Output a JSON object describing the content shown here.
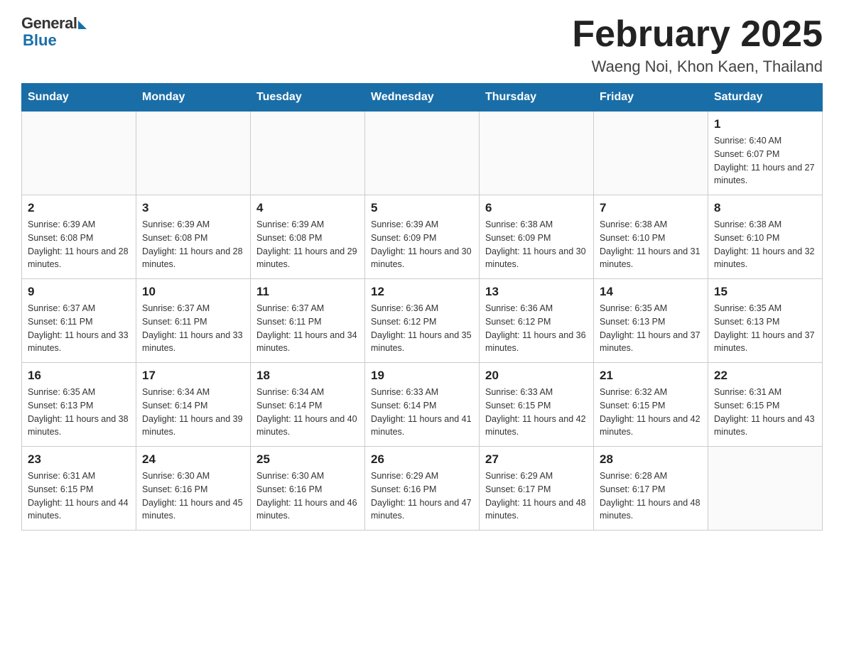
{
  "header": {
    "logo_general": "General",
    "logo_blue": "Blue",
    "month_title": "February 2025",
    "location": "Waeng Noi, Khon Kaen, Thailand"
  },
  "weekdays": [
    "Sunday",
    "Monday",
    "Tuesday",
    "Wednesday",
    "Thursday",
    "Friday",
    "Saturday"
  ],
  "weeks": [
    [
      {
        "day": "",
        "info": ""
      },
      {
        "day": "",
        "info": ""
      },
      {
        "day": "",
        "info": ""
      },
      {
        "day": "",
        "info": ""
      },
      {
        "day": "",
        "info": ""
      },
      {
        "day": "",
        "info": ""
      },
      {
        "day": "1",
        "info": "Sunrise: 6:40 AM\nSunset: 6:07 PM\nDaylight: 11 hours and 27 minutes."
      }
    ],
    [
      {
        "day": "2",
        "info": "Sunrise: 6:39 AM\nSunset: 6:08 PM\nDaylight: 11 hours and 28 minutes."
      },
      {
        "day": "3",
        "info": "Sunrise: 6:39 AM\nSunset: 6:08 PM\nDaylight: 11 hours and 28 minutes."
      },
      {
        "day": "4",
        "info": "Sunrise: 6:39 AM\nSunset: 6:08 PM\nDaylight: 11 hours and 29 minutes."
      },
      {
        "day": "5",
        "info": "Sunrise: 6:39 AM\nSunset: 6:09 PM\nDaylight: 11 hours and 30 minutes."
      },
      {
        "day": "6",
        "info": "Sunrise: 6:38 AM\nSunset: 6:09 PM\nDaylight: 11 hours and 30 minutes."
      },
      {
        "day": "7",
        "info": "Sunrise: 6:38 AM\nSunset: 6:10 PM\nDaylight: 11 hours and 31 minutes."
      },
      {
        "day": "8",
        "info": "Sunrise: 6:38 AM\nSunset: 6:10 PM\nDaylight: 11 hours and 32 minutes."
      }
    ],
    [
      {
        "day": "9",
        "info": "Sunrise: 6:37 AM\nSunset: 6:11 PM\nDaylight: 11 hours and 33 minutes."
      },
      {
        "day": "10",
        "info": "Sunrise: 6:37 AM\nSunset: 6:11 PM\nDaylight: 11 hours and 33 minutes."
      },
      {
        "day": "11",
        "info": "Sunrise: 6:37 AM\nSunset: 6:11 PM\nDaylight: 11 hours and 34 minutes."
      },
      {
        "day": "12",
        "info": "Sunrise: 6:36 AM\nSunset: 6:12 PM\nDaylight: 11 hours and 35 minutes."
      },
      {
        "day": "13",
        "info": "Sunrise: 6:36 AM\nSunset: 6:12 PM\nDaylight: 11 hours and 36 minutes."
      },
      {
        "day": "14",
        "info": "Sunrise: 6:35 AM\nSunset: 6:13 PM\nDaylight: 11 hours and 37 minutes."
      },
      {
        "day": "15",
        "info": "Sunrise: 6:35 AM\nSunset: 6:13 PM\nDaylight: 11 hours and 37 minutes."
      }
    ],
    [
      {
        "day": "16",
        "info": "Sunrise: 6:35 AM\nSunset: 6:13 PM\nDaylight: 11 hours and 38 minutes."
      },
      {
        "day": "17",
        "info": "Sunrise: 6:34 AM\nSunset: 6:14 PM\nDaylight: 11 hours and 39 minutes."
      },
      {
        "day": "18",
        "info": "Sunrise: 6:34 AM\nSunset: 6:14 PM\nDaylight: 11 hours and 40 minutes."
      },
      {
        "day": "19",
        "info": "Sunrise: 6:33 AM\nSunset: 6:14 PM\nDaylight: 11 hours and 41 minutes."
      },
      {
        "day": "20",
        "info": "Sunrise: 6:33 AM\nSunset: 6:15 PM\nDaylight: 11 hours and 42 minutes."
      },
      {
        "day": "21",
        "info": "Sunrise: 6:32 AM\nSunset: 6:15 PM\nDaylight: 11 hours and 42 minutes."
      },
      {
        "day": "22",
        "info": "Sunrise: 6:31 AM\nSunset: 6:15 PM\nDaylight: 11 hours and 43 minutes."
      }
    ],
    [
      {
        "day": "23",
        "info": "Sunrise: 6:31 AM\nSunset: 6:15 PM\nDaylight: 11 hours and 44 minutes."
      },
      {
        "day": "24",
        "info": "Sunrise: 6:30 AM\nSunset: 6:16 PM\nDaylight: 11 hours and 45 minutes."
      },
      {
        "day": "25",
        "info": "Sunrise: 6:30 AM\nSunset: 6:16 PM\nDaylight: 11 hours and 46 minutes."
      },
      {
        "day": "26",
        "info": "Sunrise: 6:29 AM\nSunset: 6:16 PM\nDaylight: 11 hours and 47 minutes."
      },
      {
        "day": "27",
        "info": "Sunrise: 6:29 AM\nSunset: 6:17 PM\nDaylight: 11 hours and 48 minutes."
      },
      {
        "day": "28",
        "info": "Sunrise: 6:28 AM\nSunset: 6:17 PM\nDaylight: 11 hours and 48 minutes."
      },
      {
        "day": "",
        "info": ""
      }
    ]
  ]
}
